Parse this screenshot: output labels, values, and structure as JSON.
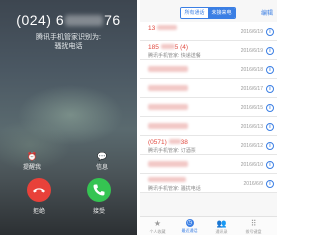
{
  "call": {
    "number_prefix": "(024) 6",
    "number_suffix": "76",
    "caller_tip_line1": "腾讯手机管家识别为:",
    "caller_tip_line2": "骚扰电话",
    "remind_label": "提醒我",
    "remind_icon": "alarm-clock-icon",
    "message_label": "信息",
    "message_icon": "message-bubble-icon",
    "decline_label": "拒绝",
    "accept_label": "接受",
    "decline_color": "#e8413a",
    "accept_color": "#35c452"
  },
  "log": {
    "tabs": [
      "所有通话",
      "未接来电"
    ],
    "active_tab": 1,
    "edit_label": "编辑",
    "entries": [
      {
        "number": "13",
        "sub": "",
        "date": "2016/6/19",
        "masked": false
      },
      {
        "number": "185",
        "number_tail": "5 (4)",
        "sub": "腾讯手机管家: 快递送餐",
        "date": "2016/6/19",
        "masked": false
      },
      {
        "number": "",
        "sub": "",
        "date": "2016/6/18",
        "masked": true
      },
      {
        "number": "",
        "sub": "",
        "date": "2016/6/17",
        "masked": true
      },
      {
        "number": "",
        "sub": "",
        "date": "2016/6/15",
        "masked": true
      },
      {
        "number": "",
        "sub": "",
        "date": "2016/6/13",
        "masked": true
      },
      {
        "number": "(0571)",
        "number_tail": "38",
        "sub": "腾讯手机管家: 订酒票",
        "date": "2016/6/12",
        "masked": false
      },
      {
        "number": "",
        "sub": "",
        "date": "2016/6/10",
        "masked": true
      },
      {
        "number": "",
        "sub": "腾讯手机管家: 骚扰电话",
        "date": "2016/6/9",
        "masked": true
      }
    ],
    "tabbar": [
      {
        "label": "个人收藏",
        "icon": "star-icon"
      },
      {
        "label": "最近通话",
        "icon": "clock-icon"
      },
      {
        "label": "通讯录",
        "icon": "contacts-icon"
      },
      {
        "label": "拨号键盘",
        "icon": "keypad-icon"
      }
    ],
    "active_tabbar": 1,
    "accent_color": "#3b7fe4"
  }
}
